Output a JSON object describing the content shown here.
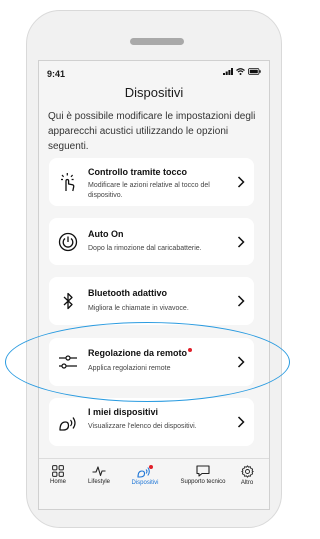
{
  "status": {
    "time": "9:41"
  },
  "header": {
    "title": "Dispositivi"
  },
  "intro": "Qui è possibile modificare le impostazioni degli apparecchi acustici utilizzando le opzioni seguenti.",
  "items": [
    {
      "title": "Controllo tramite tocco",
      "desc": "Modificare le azioni relative al tocco del dispositivo.",
      "icon": "touch-icon",
      "notification": false
    },
    {
      "title": "Auto On",
      "desc": "Dopo la rimozione dal caricabatterie.",
      "icon": "power-icon",
      "notification": false
    },
    {
      "title": "Bluetooth adattivo",
      "desc": "Migliora le chiamate in vivavoce.",
      "icon": "bluetooth-icon",
      "notification": false
    },
    {
      "title": "Regolazione da remoto",
      "desc": "Applica regolazioni remote",
      "icon": "sliders-icon",
      "notification": true
    },
    {
      "title": "I miei dispositivi",
      "desc": "Visualizzare l'elenco dei dispositivi.",
      "icon": "hearing-aid-icon",
      "notification": false
    }
  ],
  "tabs": [
    {
      "label": "Home",
      "icon": "home-grid-icon",
      "active": false
    },
    {
      "label": "Lifestyle",
      "icon": "lifestyle-icon",
      "active": false
    },
    {
      "label": "Dispositivi",
      "icon": "devices-icon",
      "active": true
    },
    {
      "label": "Supporto tecnico",
      "icon": "chat-icon",
      "active": false
    },
    {
      "label": "Altro",
      "icon": "gear-icon",
      "active": false
    }
  ],
  "colors": {
    "accent": "#1a74d6",
    "notification": "#e0202a",
    "highlight": "#2a9be0"
  }
}
